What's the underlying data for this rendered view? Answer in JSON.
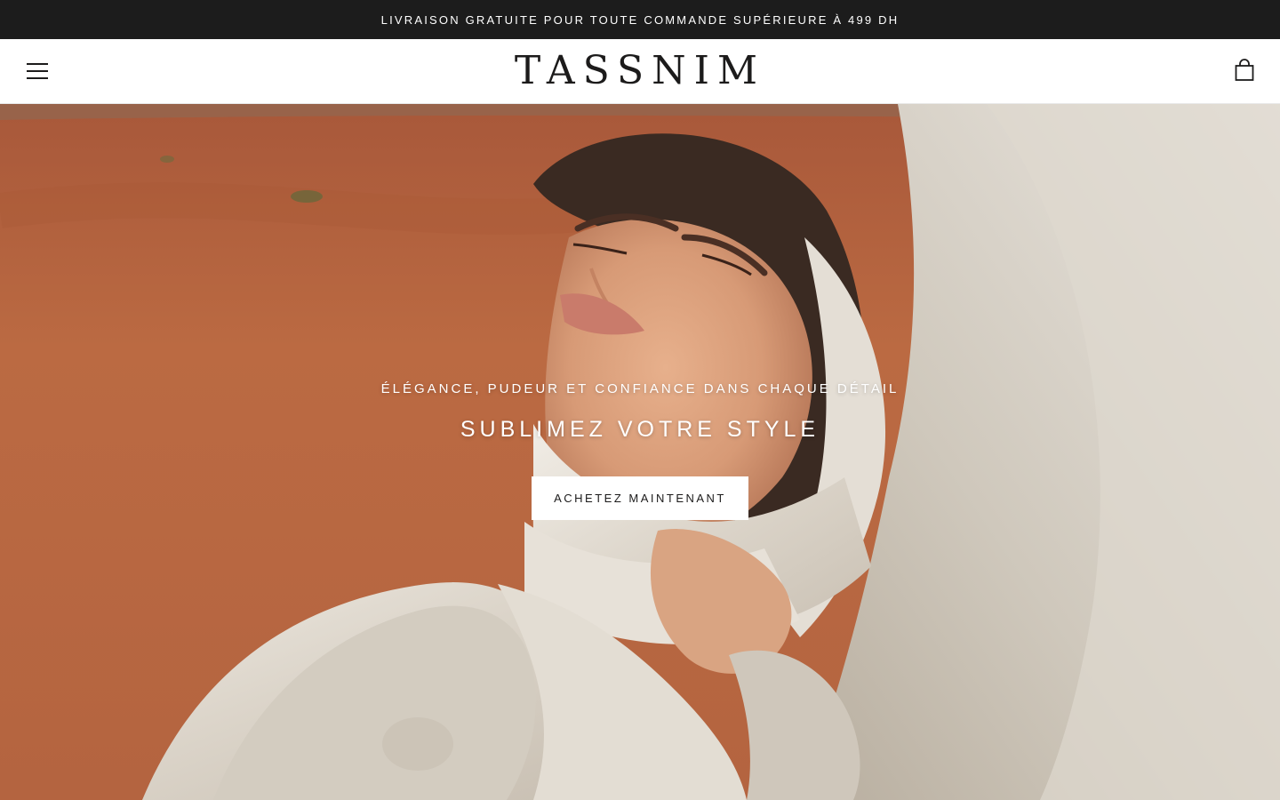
{
  "announcement": {
    "text": "LIVRAISON GRATUITE POUR TOUTE COMMANDE SUPÉRIEURE À 499 DH"
  },
  "header": {
    "logo": "TASSNIM",
    "menu_icon": "hamburger-menu-icon",
    "cart_icon": "shopping-bag-icon"
  },
  "hero": {
    "subheading": "ÉLÉGANCE, PUDEUR ET CONFIANCE DANS CHAQUE DÉTAIL",
    "heading": "SUBLIMEZ VOTRE STYLE",
    "button_label": "ACHETEZ MAINTENANT"
  },
  "colors": {
    "announcement_bg": "#1c1c1c",
    "text_dark": "#1c1b1b",
    "sand": "#b9683f",
    "fabric": "#e9e4dc"
  }
}
